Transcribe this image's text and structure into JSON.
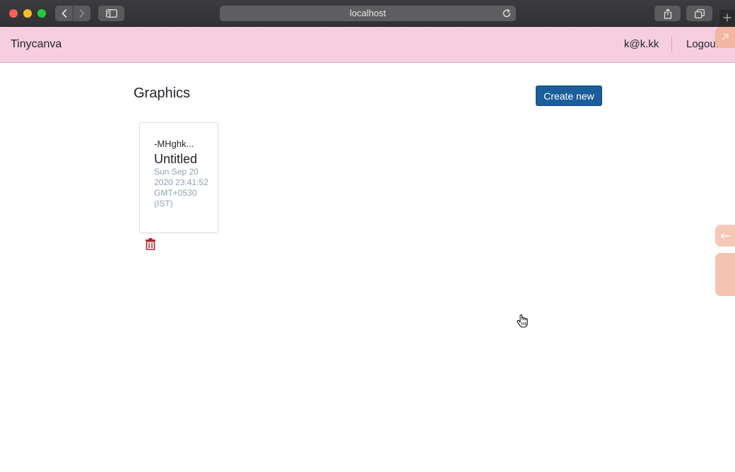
{
  "browser": {
    "url": "localhost"
  },
  "navbar": {
    "brand": "Tinycanva",
    "user_email": "k@k.kk",
    "logout_label": "Logout"
  },
  "main": {
    "title": "Graphics",
    "create_label": "Create new",
    "graphics": [
      {
        "id": "-MHghk...",
        "name": "Untitled",
        "created": "Sun Sep 20 2020 23:41:52 GMT+0530 (IST)"
      }
    ]
  },
  "icons": {
    "delete": "trash-icon",
    "side_arrow": "arrow-left-icon",
    "side_top": "arrow-up-right-icon"
  },
  "colors": {
    "navbar_bg": "#f7cedf",
    "primary_button": "#1b5e9c",
    "delete_icon": "#a3282d",
    "date_text": "#8fa1b3"
  }
}
